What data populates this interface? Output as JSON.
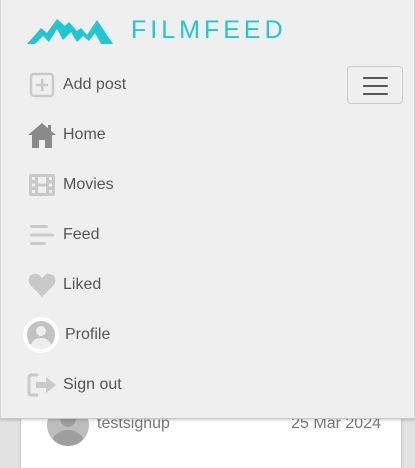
{
  "brand": {
    "name": "FILMFEED",
    "color": "#1ec7d3"
  },
  "nav": {
    "items": [
      {
        "key": "add-post",
        "label": "Add post",
        "icon": "add-post-icon"
      },
      {
        "key": "home",
        "label": "Home",
        "icon": "home-icon"
      },
      {
        "key": "movies",
        "label": "Movies",
        "icon": "film-icon"
      },
      {
        "key": "feed",
        "label": "Feed",
        "icon": "feed-icon"
      },
      {
        "key": "liked",
        "label": "Liked",
        "icon": "heart-icon"
      },
      {
        "key": "profile",
        "label": "Profile",
        "icon": "avatar-icon"
      },
      {
        "key": "sign-out",
        "label": "Sign out",
        "icon": "sign-out-icon"
      }
    ],
    "toggler_icon": "hamburger-menu-icon"
  },
  "background_post": {
    "username": "testsignup",
    "date": "25 Mar 2024"
  },
  "colors": {
    "navbar_bg": "#efefef",
    "icon_gray": "#c9c9c9",
    "text": "#555555"
  }
}
